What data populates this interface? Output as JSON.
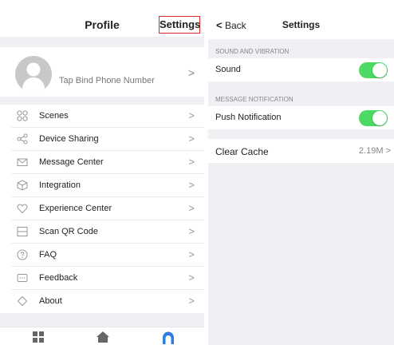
{
  "profile_screen": {
    "title": "Profile",
    "settings_link": "Settings",
    "profile_prompt": "Tap Bind Phone Number",
    "chevron": ">",
    "menu": [
      {
        "label": "Scenes",
        "icon": "scenes-icon"
      },
      {
        "label": "Device Sharing",
        "icon": "share-icon"
      },
      {
        "label": "Message Center",
        "icon": "mail-icon"
      },
      {
        "label": "Integration",
        "icon": "cube-icon"
      },
      {
        "label": "Experience Center",
        "icon": "heart-icon"
      },
      {
        "label": "Scan QR Code",
        "icon": "scan-icon"
      },
      {
        "label": "FAQ",
        "icon": "question-icon"
      },
      {
        "label": "Feedback",
        "icon": "chat-icon"
      },
      {
        "label": "About",
        "icon": "diamond-icon"
      }
    ],
    "tabs": [
      {
        "name": "grid-tab-icon",
        "active": false
      },
      {
        "name": "home-tab-icon",
        "active": false
      },
      {
        "name": "profile-tab-icon",
        "active": true
      }
    ]
  },
  "settings_screen": {
    "back_label": "Back",
    "back_chevron": "<",
    "title": "Settings",
    "sound_section": "SOUND AND VIBRATION",
    "sound_label": "Sound",
    "sound_on": true,
    "notification_section": "MESSAGE NOTIFICATION",
    "push_label": "Push Notification",
    "push_on": true,
    "cache_label": "Clear Cache",
    "cache_value": "2.19M",
    "cache_chevron": ">"
  },
  "colors": {
    "toggle_on": "#4cd964",
    "accent_blue": "#2f7de1",
    "highlight_box": "#e02a2a",
    "background_gray": "#efeff4"
  }
}
